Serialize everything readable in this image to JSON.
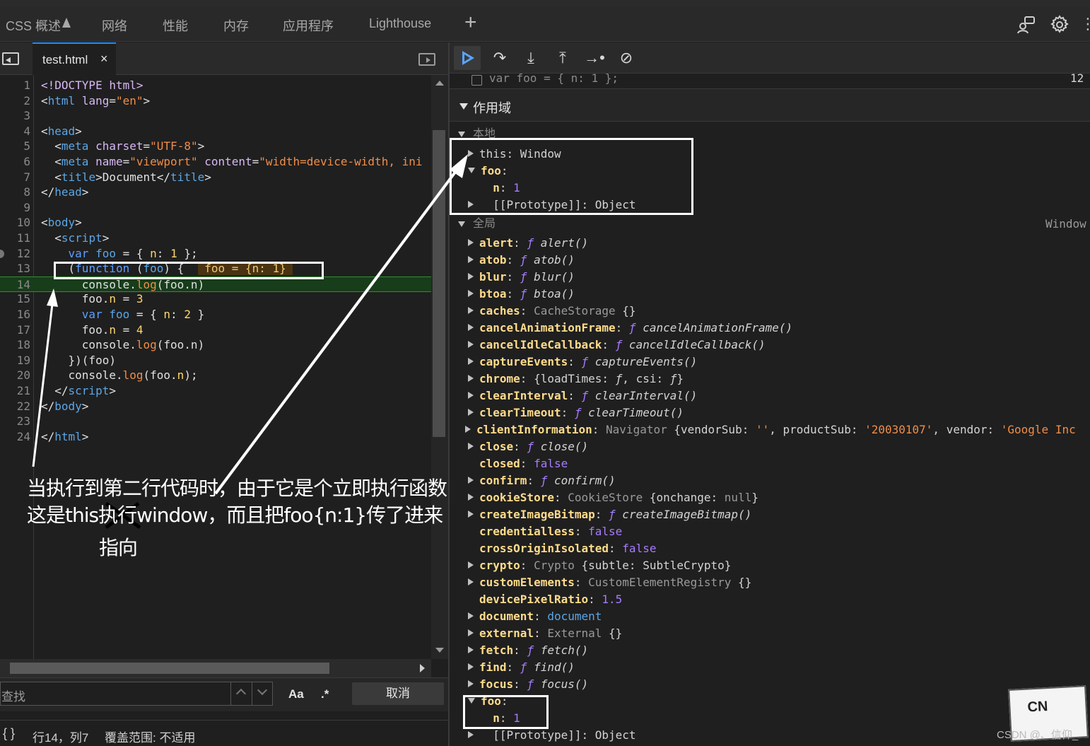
{
  "panel_tabs": [
    {
      "label": "CSS 概述"
    },
    {
      "label": "网络"
    },
    {
      "label": "性能"
    },
    {
      "label": "内存"
    },
    {
      "label": "应用程序"
    },
    {
      "label": "Lighthouse"
    }
  ],
  "file_tab": {
    "name": "test.html",
    "close": "×"
  },
  "code_lines": [
    {
      "n": "1",
      "html": "<span class='k'>&lt;!DOCTYPE html&gt;</span>"
    },
    {
      "n": "2",
      "html": "&lt;<span class='t'>html</span> <span class='k'>lang</span>=<span class='s'>\"en\"</span>&gt;"
    },
    {
      "n": "3",
      "html": ""
    },
    {
      "n": "4",
      "html": "&lt;<span class='t'>head</span>&gt;"
    },
    {
      "n": "5",
      "html": "  &lt;<span class='t'>meta</span> <span class='k'>charset</span>=<span class='s'>\"UTF-8\"</span>&gt;"
    },
    {
      "n": "6",
      "html": "  &lt;<span class='t'>meta</span> <span class='k'>name</span>=<span class='s'>\"viewport\"</span> <span class='k'>content</span>=<span class='s'>\"width=device-width, ini</span>"
    },
    {
      "n": "7",
      "html": "  &lt;<span class='t'>title</span>&gt;Document&lt;/<span class='t'>title</span>&gt;"
    },
    {
      "n": "8",
      "html": "&lt;/<span class='t'>head</span>&gt;"
    },
    {
      "n": "9",
      "html": ""
    },
    {
      "n": "10",
      "html": "&lt;<span class='t'>body</span>&gt;"
    },
    {
      "n": "11",
      "html": "  &lt;<span class='t'>script</span>&gt;"
    },
    {
      "n": "12",
      "html": "    <span class='kw'>var</span> <span class='t'>foo</span> = { <span class='fn'>n</span>: <span class='fn'>1</span> };"
    },
    {
      "n": "13",
      "html": "    (<span class='kw'>function</span> (<span class='t'>foo</span>) {  <span style='background:#4a3312;color:#f0c674'> foo = {n: 1} </span>"
    },
    {
      "n": "14",
      "html": "      console.<span class='s'>log</span>(foo.n)"
    },
    {
      "n": "15",
      "html": "      foo.<span class='fn'>n</span> = <span class='fn'>3</span>"
    },
    {
      "n": "16",
      "html": "      <span class='kw'>var</span> <span class='t'>foo</span> = { <span class='fn'>n</span>: <span class='fn'>2</span> }"
    },
    {
      "n": "17",
      "html": "      foo.<span class='fn'>n</span> = <span class='fn'>4</span>"
    },
    {
      "n": "18",
      "html": "      console.<span class='s'>log</span>(foo.n)"
    },
    {
      "n": "19",
      "html": "    })(foo)"
    },
    {
      "n": "20",
      "html": "    console.<span class='s'>log</span>(foo.<span class='fn'>n</span>);"
    },
    {
      "n": "21",
      "html": "  &lt;/<span class='t'>script</span>&gt;"
    },
    {
      "n": "22",
      "html": "&lt;/<span class='t'>body</span>&gt;"
    },
    {
      "n": "23",
      "html": ""
    },
    {
      "n": "24",
      "html": "&lt;/<span class='t'>html</span>&gt;"
    }
  ],
  "search": {
    "placeholder": "查找",
    "aa": "Aa",
    "regex": ".*",
    "cancel": "取消"
  },
  "status": {
    "braces": "{ }",
    "position": "行14，列7",
    "coverage": "覆盖范围: 不适用"
  },
  "breakpoint": {
    "code": "var foo = { n: 1 };",
    "line": "12"
  },
  "scope": {
    "title": "作用域",
    "local": "本地",
    "global": "全局",
    "global_value": "Window"
  },
  "local_rows": [
    {
      "d": "c",
      "html": "this: Window"
    },
    {
      "d": "o",
      "html": "<span class='pk'>foo</span>:"
    },
    {
      "d": "n",
      "html": "  <span class='pk'>n</span>: <span class='n'>1</span>"
    },
    {
      "d": "c",
      "html": "  [[Prototype]]: Object"
    }
  ],
  "global_rows": [
    {
      "d": "c",
      "html": "<span class='pk'>alert</span>: <span class='it'><span class='n'>ƒ</span> alert()</span>"
    },
    {
      "d": "c",
      "html": "<span class='pk'>atob</span>: <span class='it'><span class='n'>ƒ</span> atob()</span>"
    },
    {
      "d": "c",
      "html": "<span class='pk'>blur</span>: <span class='it'><span class='n'>ƒ</span> blur()</span>"
    },
    {
      "d": "c",
      "html": "<span class='pk'>btoa</span>: <span class='it'><span class='n'>ƒ</span> btoa()</span>"
    },
    {
      "d": "c",
      "html": "<span class='pk'>caches</span>: <span class='gv'>CacheStorage</span> {}"
    },
    {
      "d": "c",
      "html": "<span class='pk'>cancelAnimationFrame</span>: <span class='it'><span class='n'>ƒ</span> cancelAnimationFrame()</span>"
    },
    {
      "d": "c",
      "html": "<span class='pk'>cancelIdleCallback</span>: <span class='it'><span class='n'>ƒ</span> cancelIdleCallback()</span>"
    },
    {
      "d": "c",
      "html": "<span class='pk'>captureEvents</span>: <span class='it'><span class='n'>ƒ</span> captureEvents()</span>"
    },
    {
      "d": "c",
      "html": "<span class='pk'>chrome</span>: {loadTimes: <span class='it'>ƒ</span>, csi: <span class='it'>ƒ</span>}"
    },
    {
      "d": "c",
      "html": "<span class='pk'>clearInterval</span>: <span class='it'><span class='n'>ƒ</span> clearInterval()</span>"
    },
    {
      "d": "c",
      "html": "<span class='pk'>clearTimeout</span>: <span class='it'><span class='n'>ƒ</span> clearTimeout()</span>"
    },
    {
      "d": "w",
      "html": "<span class='pk'>clientInformation</span>: <span class='gv'>Navigator</span> {vendorSub: <span class='s'>''</span>, productSub: <span class='s'>'20030107'</span>, vendor: <span class='s'>'Google Inc</span>"
    },
    {
      "d": "c",
      "html": "<span class='pk'>close</span>: <span class='it'><span class='n'>ƒ</span> close()</span>"
    },
    {
      "d": "n",
      "html": "<span class='pk'>closed</span>: <span class='n'>false</span>"
    },
    {
      "d": "c",
      "html": "<span class='pk'>confirm</span>: <span class='it'><span class='n'>ƒ</span> confirm()</span>"
    },
    {
      "d": "c",
      "html": "<span class='pk'>cookieStore</span>: <span class='gv'>CookieStore</span> {onchange: <span class='gv'>null</span>}"
    },
    {
      "d": "c",
      "html": "<span class='pk'>createImageBitmap</span>: <span class='it'><span class='n'>ƒ</span> createImageBitmap()</span>"
    },
    {
      "d": "n",
      "html": "<span class='pk'>credentialless</span>: <span class='n'>false</span>"
    },
    {
      "d": "n",
      "html": "<span class='pk'>crossOriginIsolated</span>: <span class='n'>false</span>"
    },
    {
      "d": "c",
      "html": "<span class='pk'>crypto</span>: <span class='gv'>Crypto</span> {subtle: SubtleCrypto}"
    },
    {
      "d": "c",
      "html": "<span class='pk'>customElements</span>: <span class='gv'>CustomElementRegistry</span> {}"
    },
    {
      "d": "n",
      "html": "<span class='pk'>devicePixelRatio</span>: <span class='n'>1.5</span>"
    },
    {
      "d": "c",
      "html": "<span class='pk'>document</span>: <span class='t'>document</span>"
    },
    {
      "d": "c",
      "html": "<span class='pk'>external</span>: <span class='gv'>External</span> {}"
    },
    {
      "d": "c",
      "html": "<span class='pk'>fetch</span>: <span class='it'><span class='n'>ƒ</span> fetch()</span>"
    },
    {
      "d": "c",
      "html": "<span class='pk'>find</span>: <span class='it'><span class='n'>ƒ</span> find()</span>"
    },
    {
      "d": "c",
      "html": "<span class='pk'>focus</span>: <span class='it'><span class='n'>ƒ</span> focus()</span>"
    },
    {
      "d": "o",
      "html": "<span class='pk'>foo</span>:"
    },
    {
      "d": "n",
      "html": "  <span class='pk'>n</span>: <span class='n'>1</span>"
    },
    {
      "d": "c",
      "html": "  [[Prototype]]: Object"
    }
  ],
  "annotation": {
    "line1": "当执行到第二行代码时，由于它是个立即执行函数",
    "line2_a": "这是this",
    "line2_b": "执行",
    "line2_c": "window，而且把foo{n:1}传了进来",
    "line3": "指向"
  },
  "watermark": "CSDN @、信仰_",
  "sticker": "CN"
}
